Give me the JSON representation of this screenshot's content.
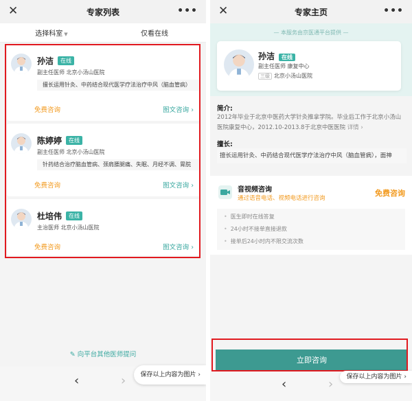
{
  "left": {
    "title": "专家列表",
    "filter": {
      "department": "选择科室",
      "online_only": "仅看在线"
    },
    "doctors": [
      {
        "name": "孙洁",
        "status": "在线",
        "meta": "副主任医师  北京小汤山医院",
        "skill": "擅长运用针灸、中药结合现代医学疗法治疗中风（脑血管病）",
        "free": "免费咨询",
        "text": "图文咨询 ›"
      },
      {
        "name": "陈婷婷",
        "status": "在线",
        "meta": "副主任医师  北京小汤山医院",
        "skill": "针药结合治疗脑血管病、颈肩腰腿痛、失眠、月经不调、胃脘",
        "free": "免费咨询",
        "text": "图文咨询 ›"
      },
      {
        "name": "杜培伟",
        "status": "在线",
        "meta": "主治医师  北京小汤山医院",
        "skill": "",
        "free": "免费咨询",
        "text": "图文咨询 ›"
      }
    ],
    "ask_other": "向平台其他医师提问",
    "save_image": "保存以上内容为图片 ›"
  },
  "right": {
    "title": "专家主页",
    "service_note": "— 本服务由京医通平台提供 —",
    "profile": {
      "name": "孙洁",
      "status": "在线",
      "title_dept": "副主任医师  康复中心",
      "grade": "三级",
      "hospital": "北京小汤山医院"
    },
    "intro_label": "简介:",
    "intro_text": "2012年毕业于北京中医药大学针灸推拿学院。毕业后工作于北京小汤山医院康复中心，2012.10-2013.8于北京中医医院",
    "intro_more": "详情 ›",
    "skill_label": "擅长:",
    "skill_text": "擅长运用针灸、中药结合现代医学疗法治疗中风（脑血管病），面神",
    "av": {
      "title": "音视频咨询",
      "subtitle": "通过语音电话、视频电话进行咨询",
      "free": "免费咨询",
      "features": [
        "医生即时在线答复",
        "24小时不接单直接退款",
        "接单后24小时内不限交流次数"
      ]
    },
    "consult_now": "立即咨询",
    "save_image": "保存以上内容为图片 ›"
  },
  "nav": {
    "close": "✕",
    "more": "•••",
    "back": "‹",
    "forward": "›"
  },
  "colors": {
    "accent": "#3aa8a0",
    "orange": "#f29a1f",
    "highlight": "#e1191f"
  },
  "icons": {
    "close": "close-icon",
    "more": "more-icon",
    "avatar": "doctor-avatar-icon",
    "edit": "edit-icon"
  }
}
